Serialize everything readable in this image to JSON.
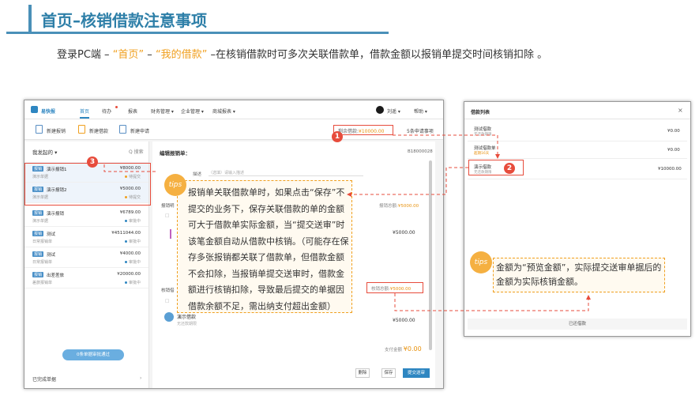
{
  "slide": {
    "title": "首页–核销借款注意事项",
    "subtitle_pre": "登录PC端 – ",
    "subtitle_hl1": "“首页”",
    "subtitle_mid": " – ",
    "subtitle_hl2": "“我的借款”",
    "subtitle_post": " –在核销借款时可多次关联借款单，借款金额以报销单提交时间核销扣除 。"
  },
  "app": {
    "logo": "易快报",
    "nav": [
      "首页",
      "待办",
      "报表",
      "财务管理 ▾",
      "企业管理 ▾",
      "商城报表 ▾"
    ],
    "user": "刘遥 ▾",
    "help": "帮助 ▾",
    "toolbar": [
      "新建报销",
      "新建借款",
      "新建申请"
    ],
    "advance_label": "剩余借款:",
    "advance_value": "¥10000.00",
    "advance_right": "5条申请事项",
    "list_head": "我发起的 ▾",
    "list_search": "Q 搜索",
    "list_items": [
      {
        "tag": "报销",
        "name": "演示报销1",
        "sub": "演示单据",
        "amount": "¥8000.00",
        "status": "待提交"
      },
      {
        "tag": "报销",
        "name": "演示报销2",
        "sub": "演示单据",
        "amount": "¥5000.00",
        "status": "待提交"
      },
      {
        "tag": "报销",
        "name": "演示报销",
        "sub": "演示单据",
        "amount": "¥6789.00",
        "status": "审批中"
      },
      {
        "tag": "报销",
        "name": "测试",
        "sub": "日常报销单",
        "amount": "¥4511044.00",
        "status": "审批中"
      },
      {
        "tag": "报销",
        "name": "测试",
        "sub": "日常报销单",
        "amount": "¥4000.00",
        "status": "审批中"
      },
      {
        "tag": "报销",
        "name": "出差差旅",
        "sub": "差旅报销单",
        "amount": "¥20000.00",
        "status": "审批中"
      }
    ],
    "approve_btn": "0条单据审批通过",
    "completed": "已完成单据",
    "completed_chev": "›",
    "form_title": "编辑报销单：",
    "form_no": "B18000028",
    "desc_label": "描述",
    "desc_placeholder": "（选填）请输入描述",
    "section1_label": "报销明",
    "section1_check": "□",
    "reim_amount_label": "报销总额:",
    "reim_amount_value": "¥5000.00",
    "detail_amt": "¥5000.00",
    "section2_label": "核销借",
    "section2_check": "□",
    "loan_amount_label": "核销总额:",
    "loan_amount_value": "¥5000.00",
    "loan_name": "演示借款",
    "loan_sub": "无还款期限",
    "loan_amt": "¥5000.00",
    "payable_label": "支付金额",
    "payable_value": "¥0.00",
    "btn_back": "删除",
    "btn_save": "保存",
    "btn_submit": "提交送审"
  },
  "tips1": {
    "badge": "tips",
    "text": "报销单关联借款单时，如果点击“保存”不提交的业务下，保存关联借款的单的金额可大于借款单实际金额，当“提交送审”时该笔金额自动从借款中核销。（可能存在保存多张报销都关联了借款单，但借款金额不会扣除，当报销单提交送审时，借款金额进行核销扣除，导致最后提交的单据因借款余额不足，需出纳支付超出金额）"
  },
  "badges": [
    "1",
    "2",
    "3"
  ],
  "popup": {
    "title": "借款列表",
    "close": "×",
    "items": [
      {
        "name": "测试借款",
        "sub": "无还款期限",
        "amount": "¥0.00"
      },
      {
        "name": "测试借款单",
        "sub": "超期16天",
        "amount": "¥0.00"
      },
      {
        "name": "演示借款",
        "sub": "无还款期限",
        "amount": "¥10000.00"
      }
    ],
    "footer": "已还借款"
  },
  "tips2": {
    "badge": "tips",
    "text": "金额为“预览金额”，实际提交送审单据后的金额为实际核销金额。"
  },
  "colors": {
    "brand": "#2e86c1",
    "title": "#2e7fa8",
    "highlight": "#f0a020",
    "red": "#e74c3c"
  }
}
